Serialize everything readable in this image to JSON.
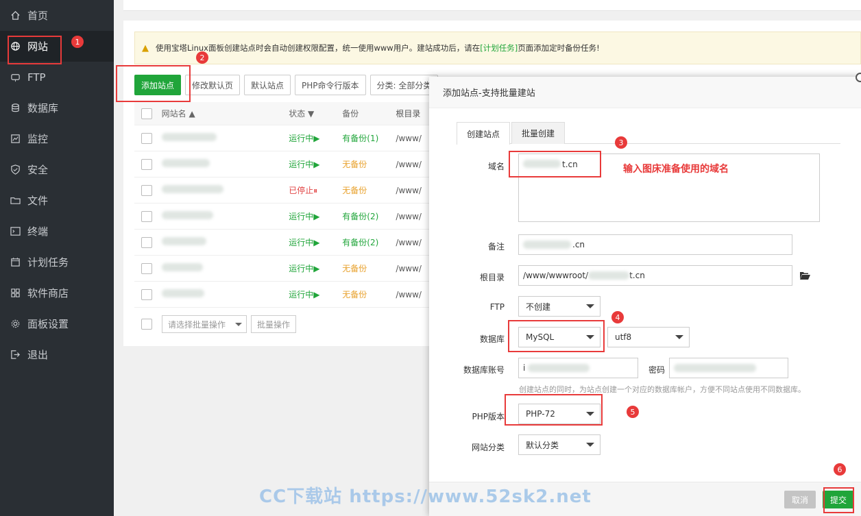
{
  "sidebar": {
    "items": [
      {
        "label": "首页",
        "icon": "home-icon"
      },
      {
        "label": "网站",
        "icon": "globe-icon"
      },
      {
        "label": "FTP",
        "icon": "ftp-icon"
      },
      {
        "label": "数据库",
        "icon": "database-icon"
      },
      {
        "label": "监控",
        "icon": "monitor-icon"
      },
      {
        "label": "安全",
        "icon": "shield-icon"
      },
      {
        "label": "文件",
        "icon": "folder-icon"
      },
      {
        "label": "终端",
        "icon": "terminal-icon"
      },
      {
        "label": "计划任务",
        "icon": "calendar-icon"
      },
      {
        "label": "软件商店",
        "icon": "grid-icon"
      },
      {
        "label": "面板设置",
        "icon": "gear-icon"
      },
      {
        "label": "退出",
        "icon": "logout-icon"
      }
    ]
  },
  "alert": {
    "text_before": "使用宝塔Linux面板创建站点时会自动创建权限配置，统一使用www用户。建站成功后，请在",
    "link": "[计划任务]",
    "text_after": "页面添加定时备份任务!"
  },
  "toolbar": {
    "add_site": "添加站点",
    "edit_default": "修改默认页",
    "default_site": "默认站点",
    "php_cli": "PHP命令行版本",
    "category": "分类: 全部分类"
  },
  "table": {
    "headers": {
      "name": "网站名 ▲",
      "status": "状态 ▼",
      "backup": "备份",
      "root": "根目录"
    },
    "rows": [
      {
        "status": "运行中▶",
        "backup": "有备份(1)",
        "root": "/www/"
      },
      {
        "status": "运行中▶",
        "backup": "无备份",
        "root": "/www/"
      },
      {
        "status": "已停止⏸",
        "backup": "无备份",
        "root": "/www/"
      },
      {
        "status": "运行中▶",
        "backup": "有备份(2)",
        "root": "/www/"
      },
      {
        "status": "运行中▶",
        "backup": "有备份(2)",
        "root": "/www/"
      },
      {
        "status": "运行中▶",
        "backup": "无备份",
        "root": "/www/"
      },
      {
        "status": "运行中▶",
        "backup": "无备份",
        "root": "/www/"
      }
    ]
  },
  "bottom": {
    "batch_select": "请选择批量操作",
    "batch_button": "批量操作"
  },
  "modal": {
    "title": "添加站点-支持批量建站",
    "tabs": [
      "创建站点",
      "批量创建"
    ],
    "domain_label": "域名",
    "domain_value": "t.cn",
    "remark_label": "备注",
    "remark_value": ".cn",
    "root_label": "根目录",
    "root_value_prefix": "/www/wwwroot/",
    "root_value_suffix": "t.cn",
    "ftp_label": "FTP",
    "ftp_value": "不创建",
    "db_label": "数据库",
    "db_value": "MySQL",
    "db_charset": "utf8",
    "db_account_label": "数据库账号",
    "db_account_value": "i",
    "db_password_label": "密码",
    "db_hint": "创建站点的同时，为站点创建一个对应的数据库帐户，方便不同站点使用不同数据库。",
    "php_label": "PHP版本",
    "php_value": "PHP-72",
    "category_label": "网站分类",
    "category_value": "默认分类",
    "cancel": "取消",
    "submit": "提交"
  },
  "annotations": {
    "badges": [
      "1",
      "2",
      "3",
      "4",
      "5",
      "6"
    ],
    "note": "输入图床准备使用的域名"
  },
  "watermark": "CC下载站 https://www.52sk2.net"
}
